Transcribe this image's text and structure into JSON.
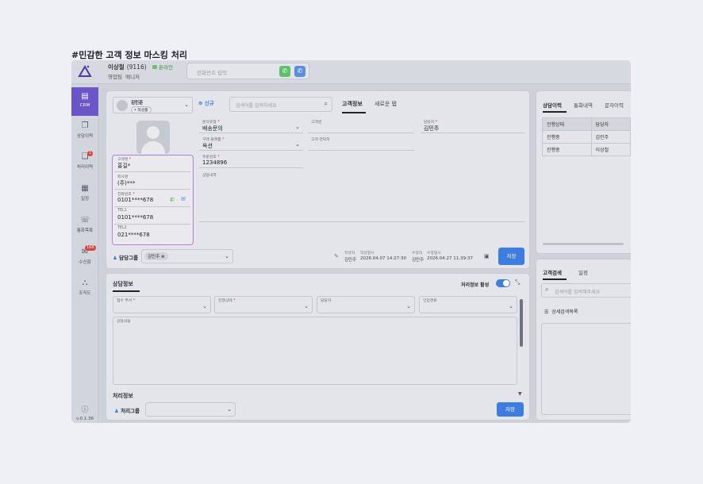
{
  "caption": "#민감한 고객 정보 마스킹 처리",
  "topbar": {
    "agent_name": "이상철",
    "agent_ext": "(9116)",
    "status": "온라인",
    "team": "영업팀",
    "role": "매니저",
    "phone_placeholder": "전화번호 입력"
  },
  "sidebar": {
    "items": [
      {
        "label": "CRM"
      },
      {
        "label": "상담이력"
      },
      {
        "label": "처리이력",
        "badge": "1"
      },
      {
        "label": "일정"
      },
      {
        "label": "통화목록"
      },
      {
        "label": "수신함",
        "badge": "168"
      },
      {
        "label": "조직도"
      }
    ],
    "version": "v.0.1.36"
  },
  "customer_card": {
    "name": "김민준",
    "tag": "• 작성중",
    "fields": [
      {
        "label": "고객명",
        "required": true,
        "value": "홍길*"
      },
      {
        "label": "회사명",
        "required": false,
        "value": "(주)***"
      },
      {
        "label": "전화번호",
        "required": true,
        "value": "0101****678"
      },
      {
        "label": "TEL1",
        "required": false,
        "value": "0101****678"
      },
      {
        "label": "TEL2",
        "required": false,
        "value": "021****678"
      }
    ]
  },
  "form": {
    "new_label": "신규",
    "search_placeholder": "검색어를 입력하세요",
    "tabs": [
      "고객정보",
      "새로운 탭"
    ],
    "inquiry_type_label": "문의유형",
    "inquiry_type_value": "배송문의",
    "customer_id_label": "고객번",
    "manager_label": "담당자",
    "manager_value": "김민주",
    "purchase_channel_label": "구매 플랫폼",
    "purchase_channel_value": "옥션",
    "contact_label": "고객 연락처",
    "order_no_label": "주문번호",
    "order_no_value": "1234896",
    "memo_label": "상담내역",
    "group_label": "담당그룹",
    "group_chip": "김민주",
    "writer_label": "작성자",
    "writer_value": "김민주",
    "written_at_label": "작성일시",
    "written_at_value": "2026.04.07 14:27:30",
    "editor_label": "수정자",
    "editor_value": "김민주",
    "edited_at_label": "수정일시",
    "edited_at_value": "2026.04.27 11:39:37",
    "save_label": "저장"
  },
  "consult": {
    "title": "상담정보",
    "toggle_label": "처리정보 활성",
    "fields": [
      {
        "label": "접수 부서",
        "required": true
      },
      {
        "label": "진행상태",
        "required": true
      },
      {
        "label": "담당자",
        "required": false
      },
      {
        "label": "인입경로",
        "required": false
      }
    ],
    "content_label": "상담내용",
    "process_title": "처리정보",
    "process_group_label": "처리그룹",
    "save_label": "저장"
  },
  "history": {
    "tabs": [
      "상담이력",
      "통화내역",
      "문자이력"
    ],
    "columns": [
      "진행상태",
      "담당자"
    ],
    "rows": [
      [
        "진행중",
        "김민주"
      ],
      [
        "진행중",
        "이상철"
      ]
    ]
  },
  "search_panel": {
    "tabs": [
      "고객검색",
      "일정"
    ],
    "placeholder": "검색어를 입력해주세요",
    "detail_label": "상세검색목록"
  },
  "colors": {
    "accent": "#6a56c9",
    "primary": "#3d7de0",
    "call_green": "#5fbf6a",
    "highlight": "#b57be6"
  }
}
